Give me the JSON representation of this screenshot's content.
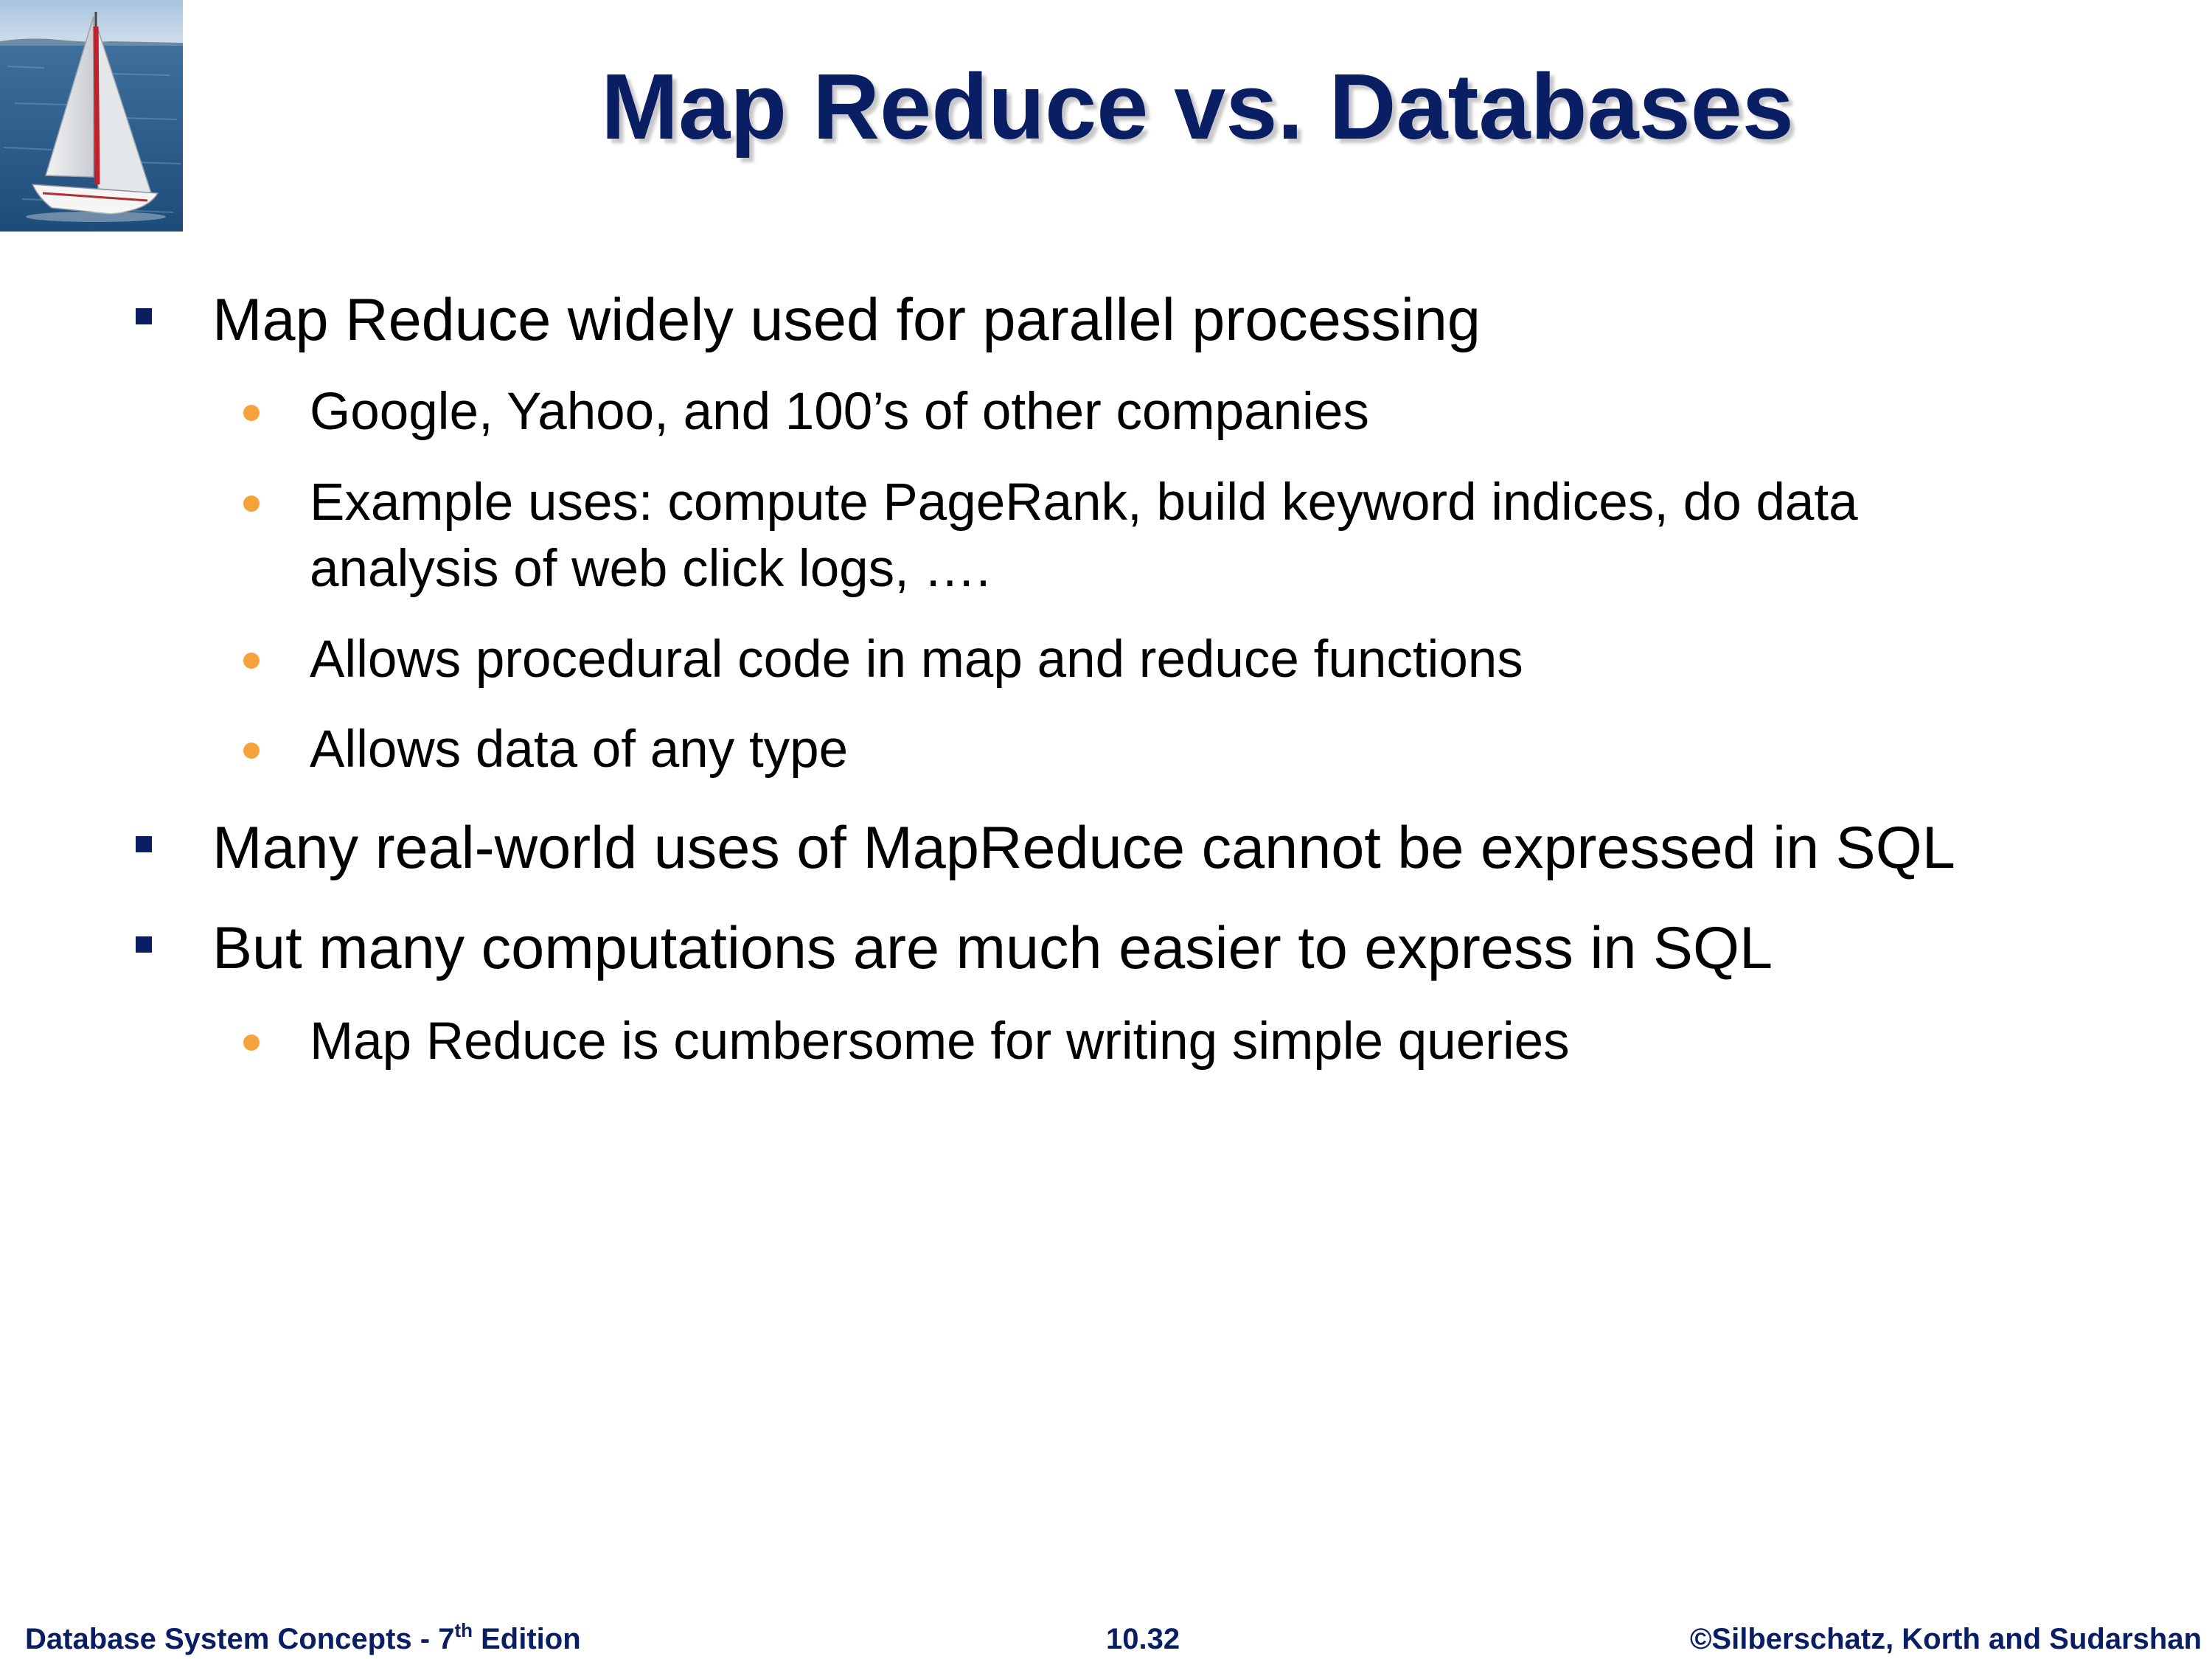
{
  "slide": {
    "title": "Map Reduce vs. Databases",
    "bullets": [
      {
        "text": "Map Reduce widely used for parallel processing"
      },
      {
        "text": "Google, Yahoo, and 100’s of other companies"
      },
      {
        "line1": "Example uses: compute PageRank, build keyword indices, do data",
        "line2": "analysis of web click logs, …."
      },
      {
        "text": "Allows procedural code in map and reduce functions"
      },
      {
        "text": "Allows data of any type"
      },
      {
        "text": "Many real-world uses of MapReduce cannot be expressed in SQL"
      },
      {
        "text": "But many computations are much easier to express in SQL"
      },
      {
        "text": "Map Reduce is cumbersome for writing simple queries"
      }
    ]
  },
  "footer": {
    "book_prefix": "Database System Concepts - 7",
    "book_sup": "th",
    "book_suffix": " Edition",
    "page_number": "10.32",
    "copyright": "©Silberschatz, Korth and Sudarshan"
  },
  "colors": {
    "title": "#0a1e64",
    "level1_bullet": "#0a1e64",
    "level2_bullet": "#f4a23a"
  },
  "icons": {
    "logo": "sailboat-photo",
    "level1_bullet": "square-bullet-icon",
    "level2_bullet": "dot-bullet-icon"
  }
}
